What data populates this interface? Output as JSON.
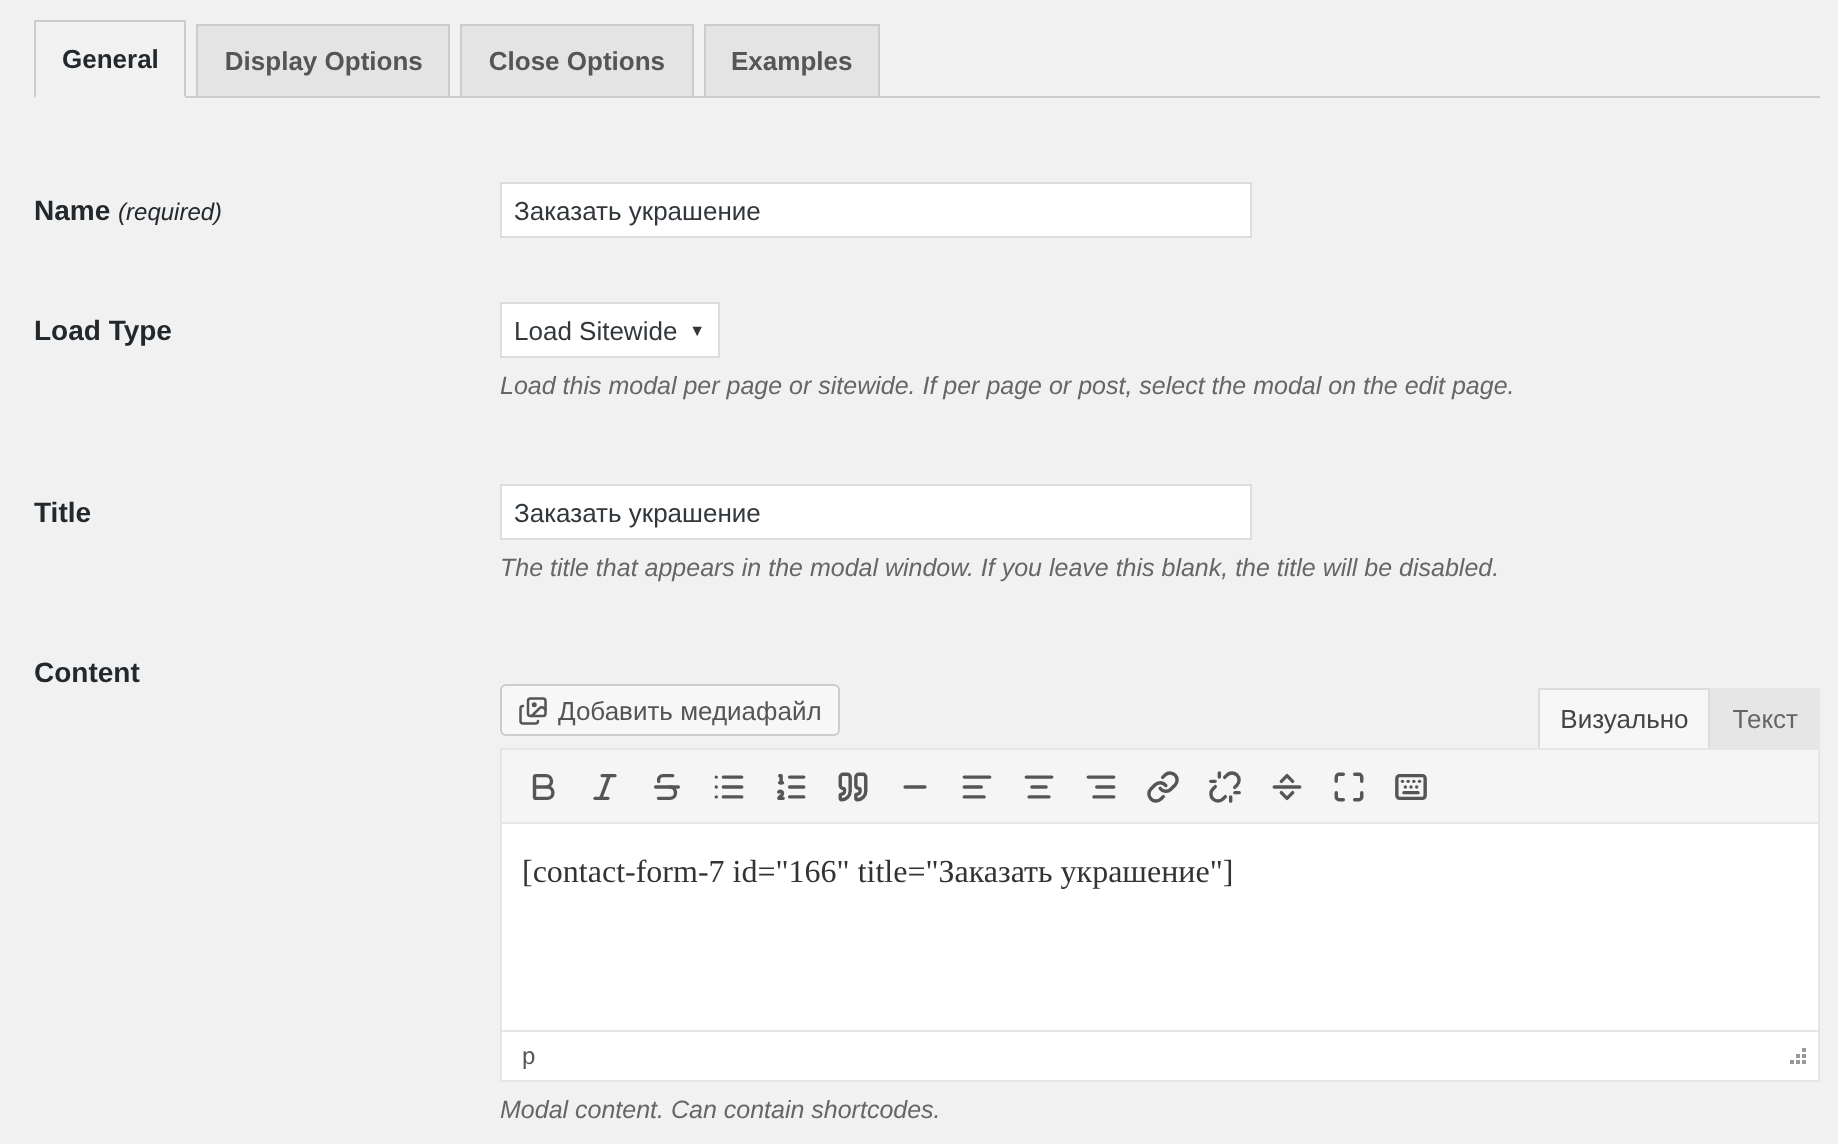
{
  "tabs": [
    {
      "label": "General",
      "selected": true
    },
    {
      "label": "Display Options",
      "selected": false
    },
    {
      "label": "Close Options",
      "selected": false
    },
    {
      "label": "Examples",
      "selected": false
    }
  ],
  "fields": [
    {
      "kind": "text",
      "label": "Name",
      "label_note": "(required)",
      "value": "Заказать украшение"
    },
    {
      "kind": "select",
      "label": "Load Type",
      "value": "Load Sitewide",
      "caret": "▼",
      "hint": "Load this modal per page or sitewide. If per page or post, select the modal on the edit page."
    },
    {
      "kind": "text",
      "label": "Title",
      "value": "Заказать украшение",
      "hint": "The title that appears in the modal window. If you leave this blank, the title will be disabled."
    },
    {
      "kind": "editor",
      "label": "Content",
      "media_button": "Добавить медиафайл",
      "modes": [
        {
          "label": "Визуально",
          "selected": true
        },
        {
          "label": "Текст",
          "selected": false
        }
      ],
      "content": "[contact-form-7 id=\"166\" title=\"Заказать украшение\"]",
      "path": "p",
      "hint": "Modal content. Can contain shortcodes."
    }
  ]
}
